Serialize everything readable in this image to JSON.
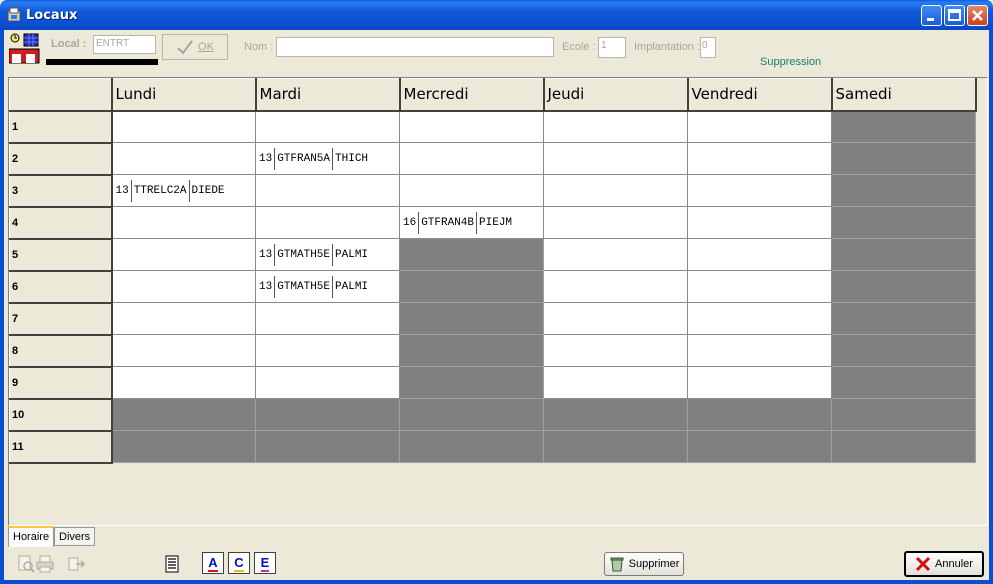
{
  "window": {
    "title": "Locaux"
  },
  "toolbar": {
    "local_label": "Local :",
    "local_value": "ENTRT",
    "ok_label": "OK",
    "nom_label": "Nom :",
    "nom_value": "",
    "ecole_label": "Ecole :",
    "ecole_value": "1",
    "implantation_label": "Implantation :",
    "implantation_value": "0",
    "status_text": "Suppression"
  },
  "grid": {
    "days": [
      "Lundi",
      "Mardi",
      "Mercredi",
      "Jeudi",
      "Vendredi",
      "Samedi"
    ],
    "rows": [
      {
        "label": "1",
        "cells": [
          "",
          "",
          "",
          "",
          "",
          "#grey"
        ]
      },
      {
        "label": "2",
        "cells": [
          "",
          "13|GTFRAN5A|THICH",
          "",
          "",
          "",
          "#grey"
        ]
      },
      {
        "label": "3",
        "cells": [
          "13|TTRELC2A|DIEDE",
          "",
          "",
          "",
          "",
          "#grey"
        ]
      },
      {
        "label": "4",
        "cells": [
          "",
          "",
          "16|GTFRAN4B|PIEJM",
          "",
          "",
          "#grey"
        ]
      },
      {
        "label": "5",
        "cells": [
          "",
          "13|GTMATH5E|PALMI",
          "#grey",
          "",
          "",
          "#grey"
        ]
      },
      {
        "label": "6",
        "cells": [
          "",
          "13|GTMATH5E|PALMI",
          "#grey",
          "",
          "",
          "#grey"
        ]
      },
      {
        "label": "7",
        "cells": [
          "",
          "",
          "#grey",
          "",
          "",
          "#grey"
        ]
      },
      {
        "label": "8",
        "cells": [
          "",
          "",
          "#grey",
          "",
          "",
          "#grey"
        ]
      },
      {
        "label": "9",
        "cells": [
          "",
          "",
          "#grey",
          "",
          "",
          "#grey"
        ]
      },
      {
        "label": "10",
        "cells": [
          "#grey",
          "#grey",
          "#grey",
          "#grey",
          "#grey",
          "#grey"
        ]
      },
      {
        "label": "11",
        "cells": [
          "#grey",
          "#grey",
          "#grey",
          "#grey",
          "#grey",
          "#grey"
        ]
      }
    ]
  },
  "tabs": [
    "Horaire",
    "Divers"
  ],
  "bottom": {
    "letter_buttons": [
      "A",
      "C",
      "E"
    ],
    "supprimer_label": "Supprimer",
    "annuler_label": "Annuler"
  },
  "colors": {
    "titlebar": "#0b4fd0",
    "unavailable": "#808080",
    "status": "#1a7b6b",
    "chrome": "#ece9d8"
  }
}
